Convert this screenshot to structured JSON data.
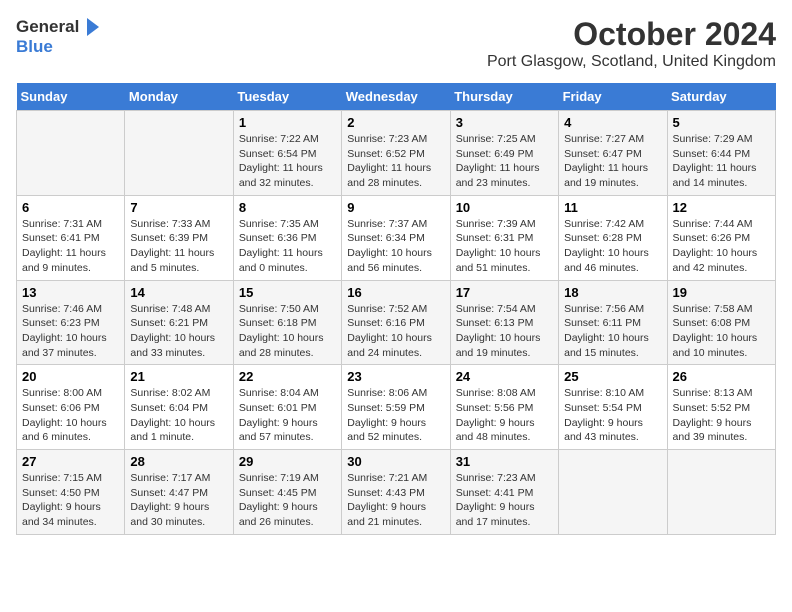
{
  "logo": {
    "general": "General",
    "blue": "Blue"
  },
  "title": "October 2024",
  "subtitle": "Port Glasgow, Scotland, United Kingdom",
  "days_header": [
    "Sunday",
    "Monday",
    "Tuesday",
    "Wednesday",
    "Thursday",
    "Friday",
    "Saturday"
  ],
  "weeks": [
    [
      {
        "day": "",
        "sunrise": "",
        "sunset": "",
        "daylight": ""
      },
      {
        "day": "",
        "sunrise": "",
        "sunset": "",
        "daylight": ""
      },
      {
        "day": "1",
        "sunrise": "Sunrise: 7:22 AM",
        "sunset": "Sunset: 6:54 PM",
        "daylight": "Daylight: 11 hours and 32 minutes."
      },
      {
        "day": "2",
        "sunrise": "Sunrise: 7:23 AM",
        "sunset": "Sunset: 6:52 PM",
        "daylight": "Daylight: 11 hours and 28 minutes."
      },
      {
        "day": "3",
        "sunrise": "Sunrise: 7:25 AM",
        "sunset": "Sunset: 6:49 PM",
        "daylight": "Daylight: 11 hours and 23 minutes."
      },
      {
        "day": "4",
        "sunrise": "Sunrise: 7:27 AM",
        "sunset": "Sunset: 6:47 PM",
        "daylight": "Daylight: 11 hours and 19 minutes."
      },
      {
        "day": "5",
        "sunrise": "Sunrise: 7:29 AM",
        "sunset": "Sunset: 6:44 PM",
        "daylight": "Daylight: 11 hours and 14 minutes."
      }
    ],
    [
      {
        "day": "6",
        "sunrise": "Sunrise: 7:31 AM",
        "sunset": "Sunset: 6:41 PM",
        "daylight": "Daylight: 11 hours and 9 minutes."
      },
      {
        "day": "7",
        "sunrise": "Sunrise: 7:33 AM",
        "sunset": "Sunset: 6:39 PM",
        "daylight": "Daylight: 11 hours and 5 minutes."
      },
      {
        "day": "8",
        "sunrise": "Sunrise: 7:35 AM",
        "sunset": "Sunset: 6:36 PM",
        "daylight": "Daylight: 11 hours and 0 minutes."
      },
      {
        "day": "9",
        "sunrise": "Sunrise: 7:37 AM",
        "sunset": "Sunset: 6:34 PM",
        "daylight": "Daylight: 10 hours and 56 minutes."
      },
      {
        "day": "10",
        "sunrise": "Sunrise: 7:39 AM",
        "sunset": "Sunset: 6:31 PM",
        "daylight": "Daylight: 10 hours and 51 minutes."
      },
      {
        "day": "11",
        "sunrise": "Sunrise: 7:42 AM",
        "sunset": "Sunset: 6:28 PM",
        "daylight": "Daylight: 10 hours and 46 minutes."
      },
      {
        "day": "12",
        "sunrise": "Sunrise: 7:44 AM",
        "sunset": "Sunset: 6:26 PM",
        "daylight": "Daylight: 10 hours and 42 minutes."
      }
    ],
    [
      {
        "day": "13",
        "sunrise": "Sunrise: 7:46 AM",
        "sunset": "Sunset: 6:23 PM",
        "daylight": "Daylight: 10 hours and 37 minutes."
      },
      {
        "day": "14",
        "sunrise": "Sunrise: 7:48 AM",
        "sunset": "Sunset: 6:21 PM",
        "daylight": "Daylight: 10 hours and 33 minutes."
      },
      {
        "day": "15",
        "sunrise": "Sunrise: 7:50 AM",
        "sunset": "Sunset: 6:18 PM",
        "daylight": "Daylight: 10 hours and 28 minutes."
      },
      {
        "day": "16",
        "sunrise": "Sunrise: 7:52 AM",
        "sunset": "Sunset: 6:16 PM",
        "daylight": "Daylight: 10 hours and 24 minutes."
      },
      {
        "day": "17",
        "sunrise": "Sunrise: 7:54 AM",
        "sunset": "Sunset: 6:13 PM",
        "daylight": "Daylight: 10 hours and 19 minutes."
      },
      {
        "day": "18",
        "sunrise": "Sunrise: 7:56 AM",
        "sunset": "Sunset: 6:11 PM",
        "daylight": "Daylight: 10 hours and 15 minutes."
      },
      {
        "day": "19",
        "sunrise": "Sunrise: 7:58 AM",
        "sunset": "Sunset: 6:08 PM",
        "daylight": "Daylight: 10 hours and 10 minutes."
      }
    ],
    [
      {
        "day": "20",
        "sunrise": "Sunrise: 8:00 AM",
        "sunset": "Sunset: 6:06 PM",
        "daylight": "Daylight: 10 hours and 6 minutes."
      },
      {
        "day": "21",
        "sunrise": "Sunrise: 8:02 AM",
        "sunset": "Sunset: 6:04 PM",
        "daylight": "Daylight: 10 hours and 1 minute."
      },
      {
        "day": "22",
        "sunrise": "Sunrise: 8:04 AM",
        "sunset": "Sunset: 6:01 PM",
        "daylight": "Daylight: 9 hours and 57 minutes."
      },
      {
        "day": "23",
        "sunrise": "Sunrise: 8:06 AM",
        "sunset": "Sunset: 5:59 PM",
        "daylight": "Daylight: 9 hours and 52 minutes."
      },
      {
        "day": "24",
        "sunrise": "Sunrise: 8:08 AM",
        "sunset": "Sunset: 5:56 PM",
        "daylight": "Daylight: 9 hours and 48 minutes."
      },
      {
        "day": "25",
        "sunrise": "Sunrise: 8:10 AM",
        "sunset": "Sunset: 5:54 PM",
        "daylight": "Daylight: 9 hours and 43 minutes."
      },
      {
        "day": "26",
        "sunrise": "Sunrise: 8:13 AM",
        "sunset": "Sunset: 5:52 PM",
        "daylight": "Daylight: 9 hours and 39 minutes."
      }
    ],
    [
      {
        "day": "27",
        "sunrise": "Sunrise: 7:15 AM",
        "sunset": "Sunset: 4:50 PM",
        "daylight": "Daylight: 9 hours and 34 minutes."
      },
      {
        "day": "28",
        "sunrise": "Sunrise: 7:17 AM",
        "sunset": "Sunset: 4:47 PM",
        "daylight": "Daylight: 9 hours and 30 minutes."
      },
      {
        "day": "29",
        "sunrise": "Sunrise: 7:19 AM",
        "sunset": "Sunset: 4:45 PM",
        "daylight": "Daylight: 9 hours and 26 minutes."
      },
      {
        "day": "30",
        "sunrise": "Sunrise: 7:21 AM",
        "sunset": "Sunset: 4:43 PM",
        "daylight": "Daylight: 9 hours and 21 minutes."
      },
      {
        "day": "31",
        "sunrise": "Sunrise: 7:23 AM",
        "sunset": "Sunset: 4:41 PM",
        "daylight": "Daylight: 9 hours and 17 minutes."
      },
      {
        "day": "",
        "sunrise": "",
        "sunset": "",
        "daylight": ""
      },
      {
        "day": "",
        "sunrise": "",
        "sunset": "",
        "daylight": ""
      }
    ]
  ]
}
